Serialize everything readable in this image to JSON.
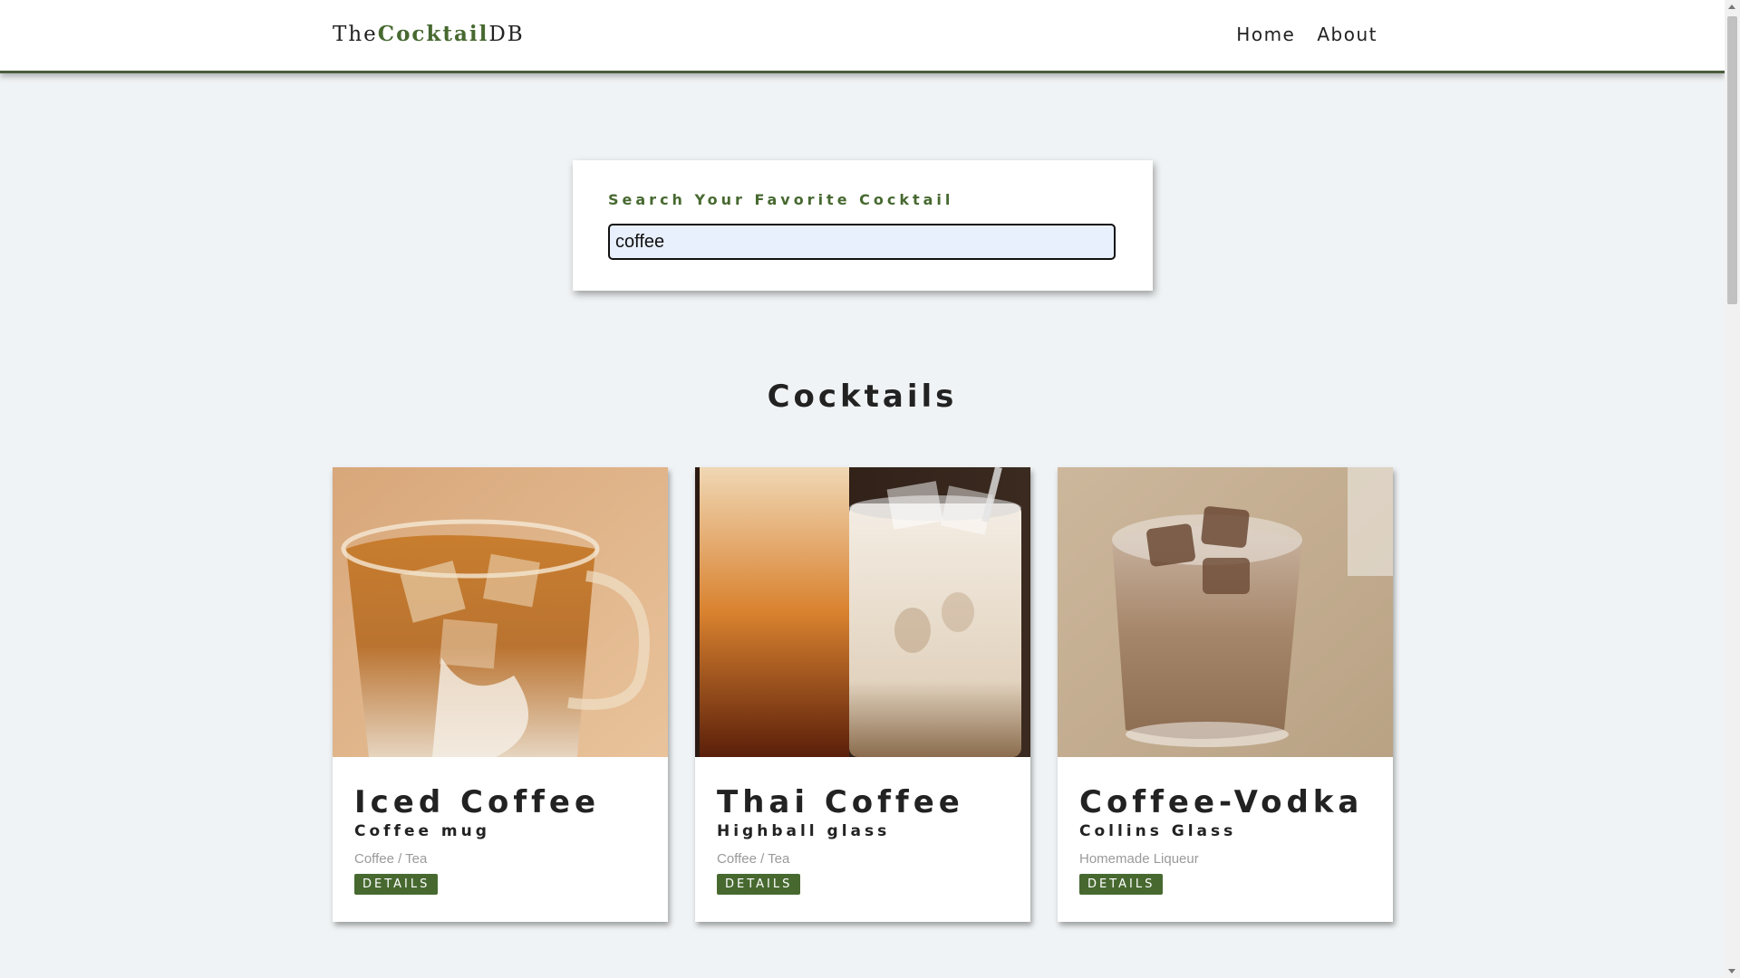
{
  "navbar": {
    "brand_prefix": "The",
    "brand_accent": "Cocktail",
    "brand_suffix": "DB",
    "links": [
      "Home",
      "About"
    ]
  },
  "search": {
    "label": "Search Your Favorite Cocktail",
    "value": "coffee"
  },
  "section_title": "Cocktails",
  "cards": [
    {
      "title": "Iced Coffee",
      "glass": "Coffee mug",
      "category": "Coffee / Tea",
      "button": "DETAILS"
    },
    {
      "title": "Thai Coffee",
      "glass": "Highball glass",
      "category": "Coffee / Tea",
      "button": "DETAILS"
    },
    {
      "title": "Coffee-Vodka",
      "glass": "Collins Glass",
      "category": "Homemade Liqueur",
      "button": "DETAILS"
    }
  ],
  "colors": {
    "accent": "#476930",
    "background": "#f0f3f5",
    "input_bg": "#e8f0fe"
  }
}
